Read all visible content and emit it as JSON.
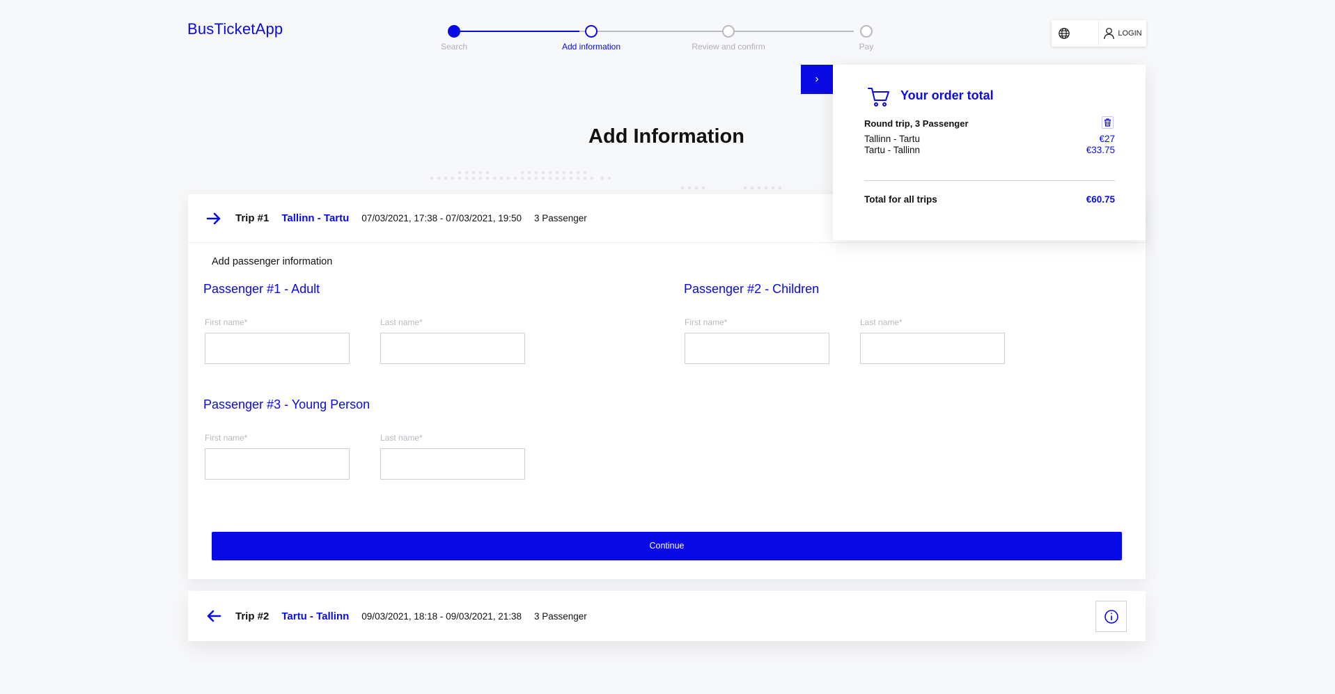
{
  "app": {
    "brand": "BusTicketApp"
  },
  "stepper": {
    "steps": [
      "Search",
      "Add information",
      "Review and confirm",
      "Pay"
    ],
    "current": "Add information"
  },
  "header": {
    "login_label": "LOGIN"
  },
  "page": {
    "title": "Add Information"
  },
  "trip1": {
    "number": "Trip #1",
    "route": "Tallinn - Tartu",
    "dates": "07/03/2021, 17:38 - 07/03/2021, 19:50",
    "passengers": "3 Passenger"
  },
  "form": {
    "section_label": "Add passenger information",
    "passengers": [
      {
        "title": "Passenger #1 - Adult"
      },
      {
        "title": "Passenger #2 - Children"
      },
      {
        "title": "Passenger #3 - Young Person"
      }
    ],
    "first_name_label": "First name*",
    "last_name_label": "Last name*",
    "continue_label": "Continue"
  },
  "trip2": {
    "number": "Trip #2",
    "route": "Tartu - Tallinn",
    "dates": "09/03/2021, 18:18 - 09/03/2021, 21:38",
    "passengers": "3 Passenger"
  },
  "order": {
    "title": "Your order total",
    "summary": "Round trip, 3 Passenger",
    "lines": [
      {
        "route": "Tallinn - Tartu",
        "price": "€27"
      },
      {
        "route": "Tartu - Tallinn",
        "price": "€33.75"
      }
    ],
    "total_label": "Total for all trips",
    "total_value": "€60.75"
  },
  "colors": {
    "accent": "#0a0ae6",
    "background": "#f7f8fa"
  }
}
